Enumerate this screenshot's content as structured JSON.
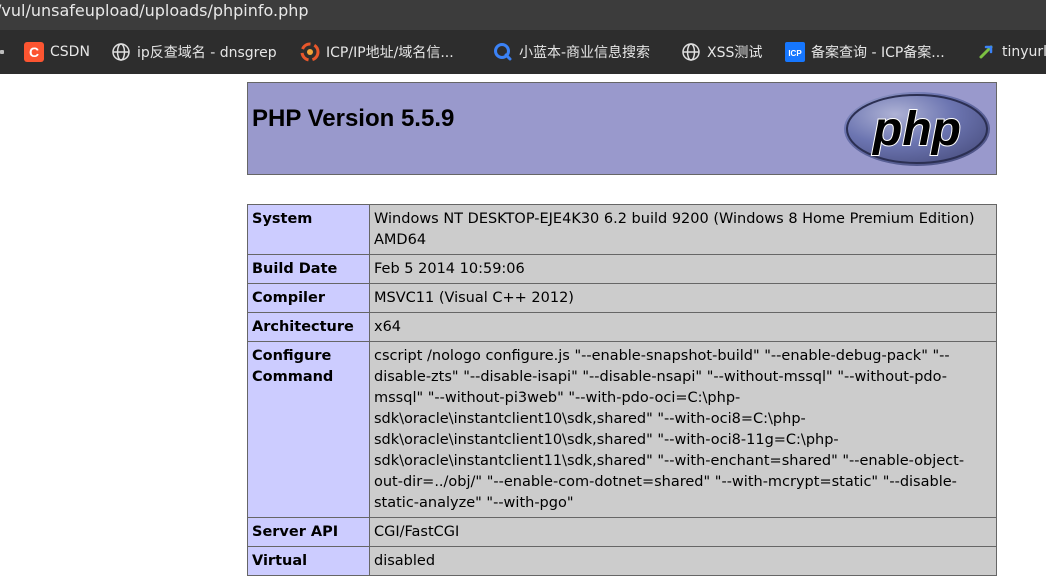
{
  "browser": {
    "url": "/vul/unsafeupload/uploads/phpinfo.php",
    "bookmarks": [
      {
        "label": "CSDN",
        "icon": "csdn-icon",
        "color": "#fc5531"
      },
      {
        "label": "ip反查域名 - dnsgrep",
        "icon": "globe-icon"
      },
      {
        "label": "ICP/IP地址/域名信...",
        "icon": "icp-swirl-icon",
        "color": "#e8572b"
      },
      {
        "label": "小蓝本-商业信息搜索",
        "icon": "xiaolanben-icon",
        "color": "#3b82f6"
      },
      {
        "label": "XSS测试",
        "icon": "globe-icon"
      },
      {
        "label": "备案查询 - ICP备案...",
        "icon": "icp-badge-icon",
        "color": "#1677ff"
      },
      {
        "label": "tinyurl",
        "icon": "tinyurl-icon"
      }
    ]
  },
  "phpinfo": {
    "title": "PHP Version 5.5.9",
    "logo_text": "php",
    "colors": {
      "header": "#9999cc",
      "key": "#ccccff",
      "value": "#cccccc"
    },
    "rows": [
      {
        "key": "System",
        "value": "Windows NT DESKTOP-EJE4K30 6.2 build 9200 (Windows 8 Home Premium Edition) AMD64"
      },
      {
        "key": "Build Date",
        "value": "Feb 5 2014 10:59:06"
      },
      {
        "key": "Compiler",
        "value": "MSVC11 (Visual C++ 2012)"
      },
      {
        "key": "Architecture",
        "value": "x64"
      },
      {
        "key": "Configure Command",
        "value": "cscript /nologo configure.js \"--enable-snapshot-build\" \"--enable-debug-pack\" \"--disable-zts\" \"--disable-isapi\" \"--disable-nsapi\" \"--without-mssql\" \"--without-pdo-mssql\" \"--without-pi3web\" \"--with-pdo-oci=C:\\php-sdk\\oracle\\instantclient10\\sdk,shared\" \"--with-oci8=C:\\php-sdk\\oracle\\instantclient10\\sdk,shared\" \"--with-oci8-11g=C:\\php-sdk\\oracle\\instantclient11\\sdk,shared\" \"--with-enchant=shared\" \"--enable-object-out-dir=../obj/\" \"--enable-com-dotnet=shared\" \"--with-mcrypt=static\" \"--disable-static-analyze\" \"--with-pgo\""
      },
      {
        "key": "Server API",
        "value": "CGI/FastCGI"
      },
      {
        "key": "Virtual",
        "value": "disabled"
      }
    ]
  }
}
